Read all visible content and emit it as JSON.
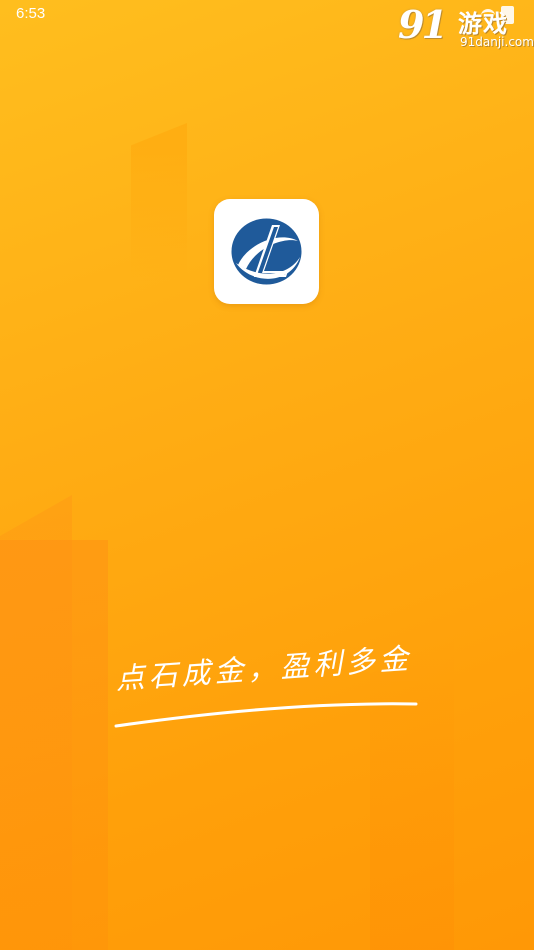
{
  "status_bar": {
    "time": "6:53",
    "icons": [
      "wifi-icon",
      "battery-icon"
    ]
  },
  "watermark": {
    "logo": "91",
    "text": "游戏",
    "domain": "91danji.com"
  },
  "app_icon": {
    "icon": "app-logo-icon",
    "colors": {
      "primary": "#1f5a9a",
      "background": "#ffffff"
    }
  },
  "slogan": {
    "text": "点石成金，盈利多金"
  },
  "theme": {
    "background_top": "#ffbe1e",
    "background_bottom": "#ff9806"
  }
}
